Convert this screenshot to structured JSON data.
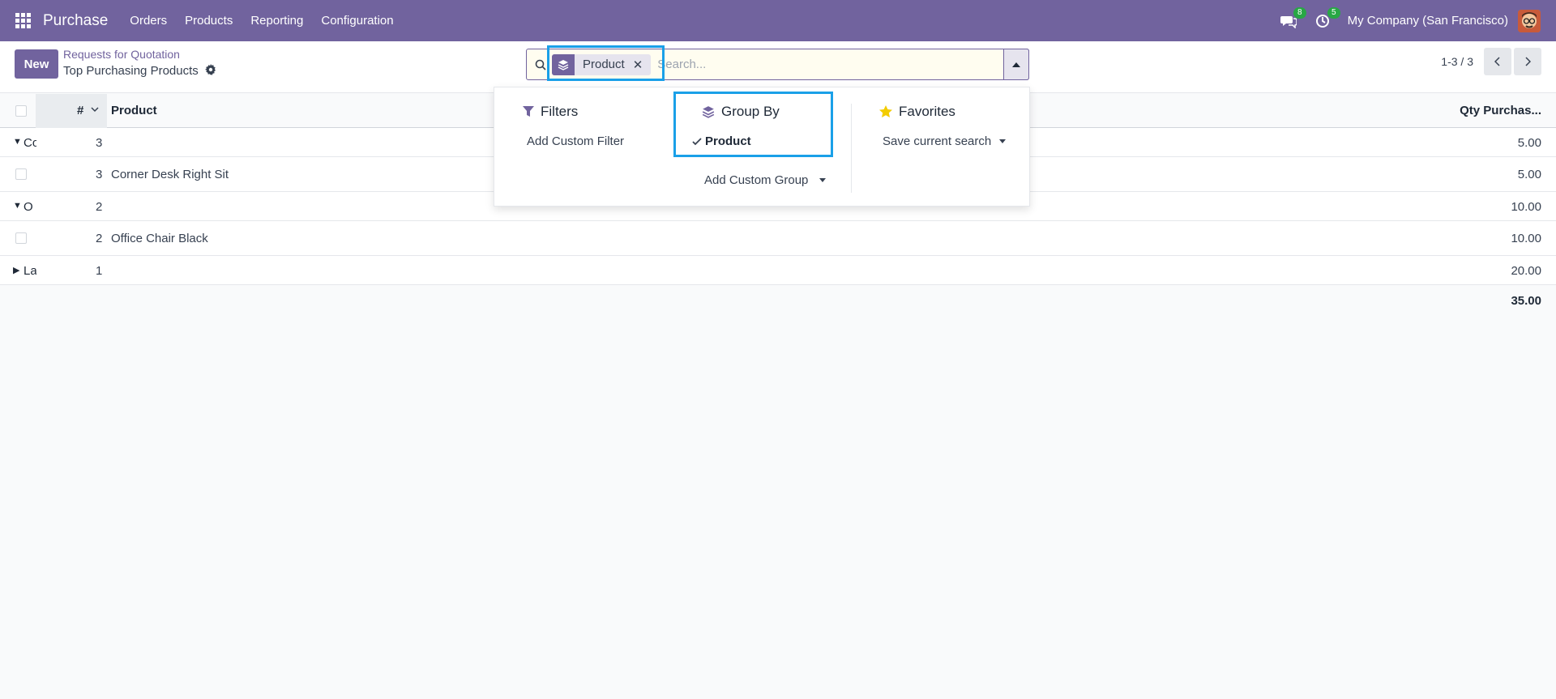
{
  "navbar": {
    "app_name": "Purchase",
    "menu": [
      "Orders",
      "Products",
      "Reporting",
      "Configuration"
    ],
    "messages_count": "8",
    "activities_count": "5",
    "company": "My Company (San Francisco)"
  },
  "control": {
    "new_label": "New",
    "breadcrumb": "Requests for Quotation",
    "title": "Top Purchasing Products",
    "search": {
      "facet_label": "Product",
      "placeholder": "Search..."
    },
    "pager": "1-3 / 3"
  },
  "dropdown": {
    "filters_title": "Filters",
    "add_custom_filter": "Add Custom Filter",
    "groupby_title": "Group By",
    "groupby_selected": "Product",
    "add_custom_group": "Add Custom Group",
    "favorites_title": "Favorites",
    "save_current_search": "Save current search"
  },
  "table": {
    "headers": {
      "num": "#",
      "product": "Product",
      "qty": "Qty Purchas..."
    },
    "groups": [
      {
        "label": "Co",
        "count": "3",
        "qty": "5.00",
        "expanded": true,
        "rows": [
          {
            "count": "3",
            "product": "Corner Desk Right Sit",
            "qty": "5.00"
          }
        ]
      },
      {
        "label": "O",
        "count": "2",
        "qty": "10.00",
        "expanded": true,
        "rows": [
          {
            "count": "2",
            "product": "Office Chair Black",
            "qty": "10.00"
          }
        ]
      },
      {
        "label": "La",
        "count": "1",
        "qty": "20.00",
        "expanded": false,
        "rows": []
      }
    ],
    "total": "35.00"
  },
  "colors": {
    "brand": "#71639e",
    "highlight": "#1aa0e8",
    "badge": "#28a745"
  }
}
